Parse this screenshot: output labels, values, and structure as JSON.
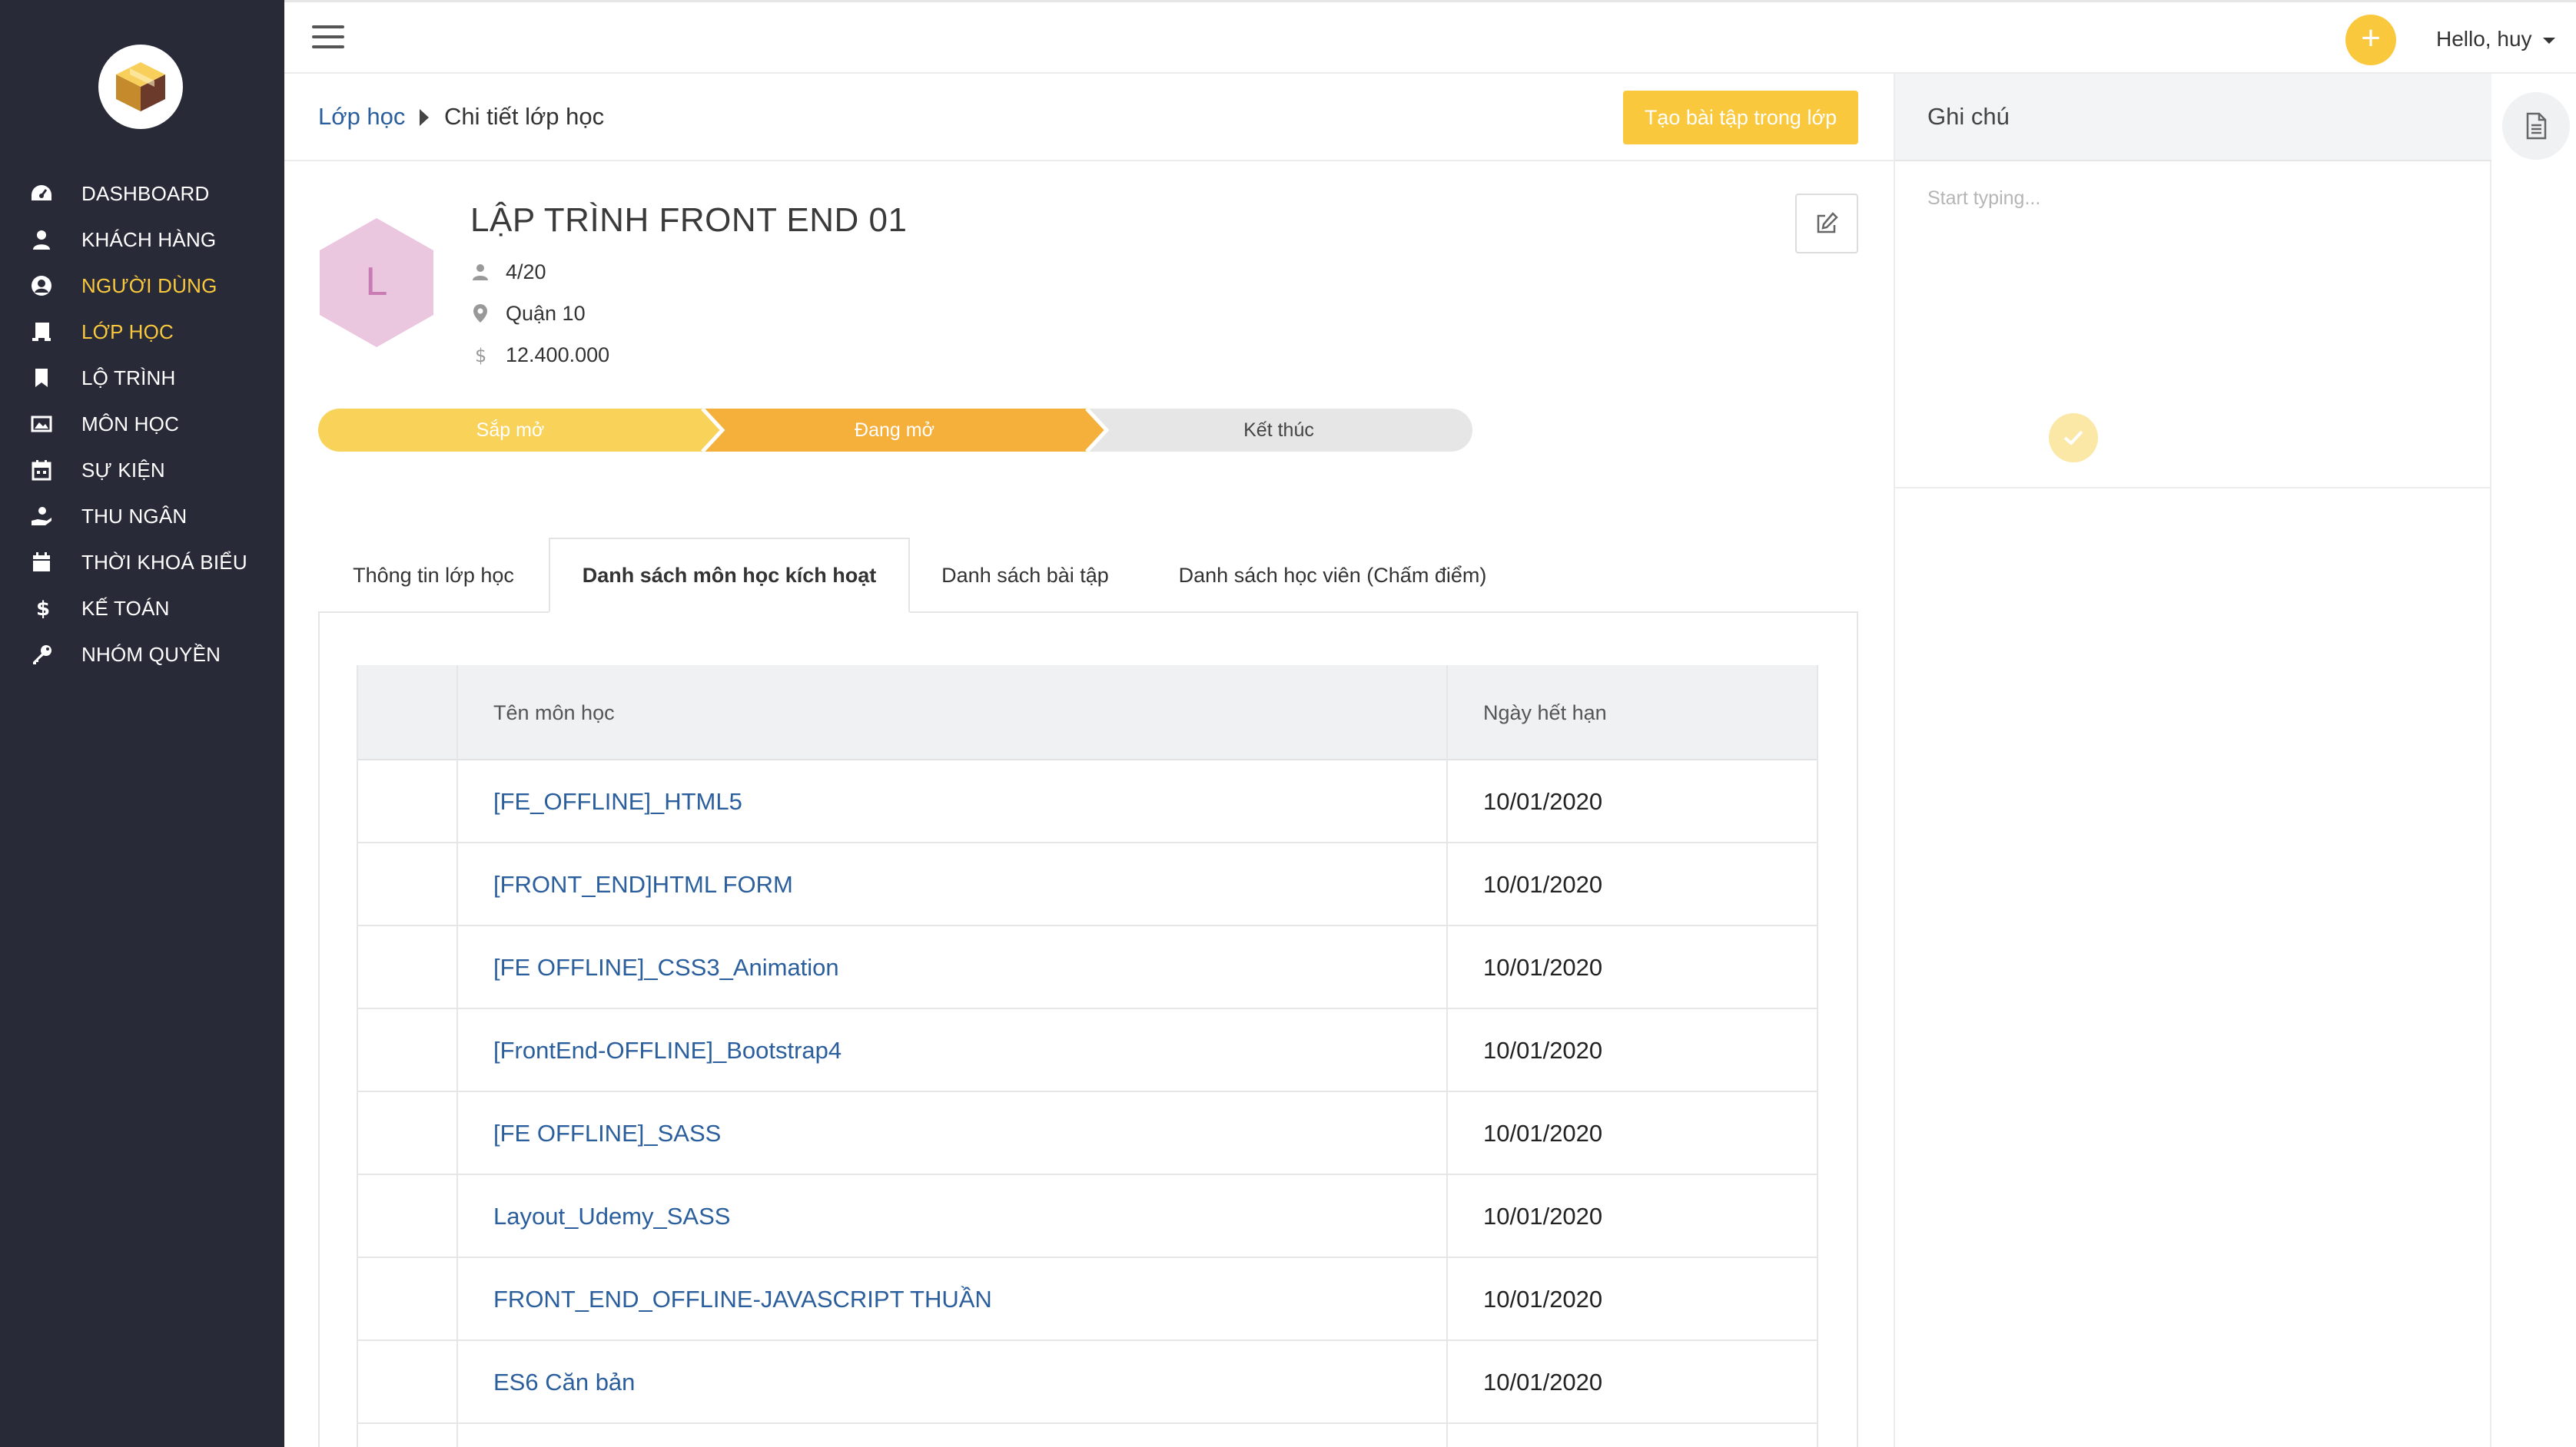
{
  "sidebar": {
    "items": [
      {
        "label": "DASHBOARD",
        "icon": "dashboard-icon"
      },
      {
        "label": "KHÁCH HÀNG",
        "icon": "user-icon"
      },
      {
        "label": "NGƯỜI DÙNG",
        "icon": "user-circle-icon"
      },
      {
        "label": "LỚP HỌC",
        "icon": "classroom-icon"
      },
      {
        "label": "LỘ TRÌNH",
        "icon": "bookmark-icon"
      },
      {
        "label": "MÔN HỌC",
        "icon": "image-icon"
      },
      {
        "label": "SỰ KIỆN",
        "icon": "calendar-icon"
      },
      {
        "label": "THU NGÂN",
        "icon": "cash-hand-icon"
      },
      {
        "label": "THỜI KHOÁ BIỂU",
        "icon": "calendar-full-icon"
      },
      {
        "label": "KẾ TOÁN",
        "icon": "dollar-icon"
      },
      {
        "label": "NHÓM QUYỀN",
        "icon": "key-icon"
      }
    ]
  },
  "topbar": {
    "greeting": "Hello, huy",
    "plus_label": "+"
  },
  "breadcrumb": {
    "parent": "Lớp học",
    "current": "Chi tiết lớp học"
  },
  "actions": {
    "create_assignment": "Tạo bài tập trong lớp"
  },
  "class_info": {
    "avatar_letter": "L",
    "title": "LẬP TRÌNH FRONT END 01",
    "students": "4/20",
    "location": "Quận 10",
    "price": "12.400.000"
  },
  "steps": [
    {
      "label": "Sắp mở"
    },
    {
      "label": "Đang mở"
    },
    {
      "label": "Kết thúc"
    }
  ],
  "tabs": [
    {
      "label": "Thông tin lớp học"
    },
    {
      "label": "Danh sách môn học kích hoạt"
    },
    {
      "label": "Danh sách bài tập"
    },
    {
      "label": "Danh sách học viên (Chấm điểm)"
    }
  ],
  "table": {
    "headers": {
      "name": "Tên môn học",
      "expiry": "Ngày hết hạn"
    },
    "rows": [
      {
        "name": "[FE_OFFLINE]_HTML5",
        "expiry": "10/01/2020"
      },
      {
        "name": "[FRONT_END]HTML FORM",
        "expiry": "10/01/2020"
      },
      {
        "name": "[FE OFFLINE]_CSS3_Animation",
        "expiry": "10/01/2020"
      },
      {
        "name": "[FrontEnd-OFFLINE]_Bootstrap4",
        "expiry": "10/01/2020"
      },
      {
        "name": "[FE OFFLINE]_SASS",
        "expiry": "10/01/2020"
      },
      {
        "name": "Layout_Udemy_SASS",
        "expiry": "10/01/2020"
      },
      {
        "name": "FRONT_END_OFFLINE-JAVASCRIPT THUẦN",
        "expiry": "10/01/2020"
      },
      {
        "name": "ES6 Căn bản",
        "expiry": "10/01/2020"
      }
    ]
  },
  "notes": {
    "title": "Ghi chú",
    "placeholder": "Start typing..."
  },
  "colors": {
    "sidebar_bg": "#292a38",
    "accent_yellow": "#f9c83c",
    "step_active": "#f5b03c",
    "link_blue": "#2b5e9c",
    "avatar_pink": "#eac6df"
  }
}
